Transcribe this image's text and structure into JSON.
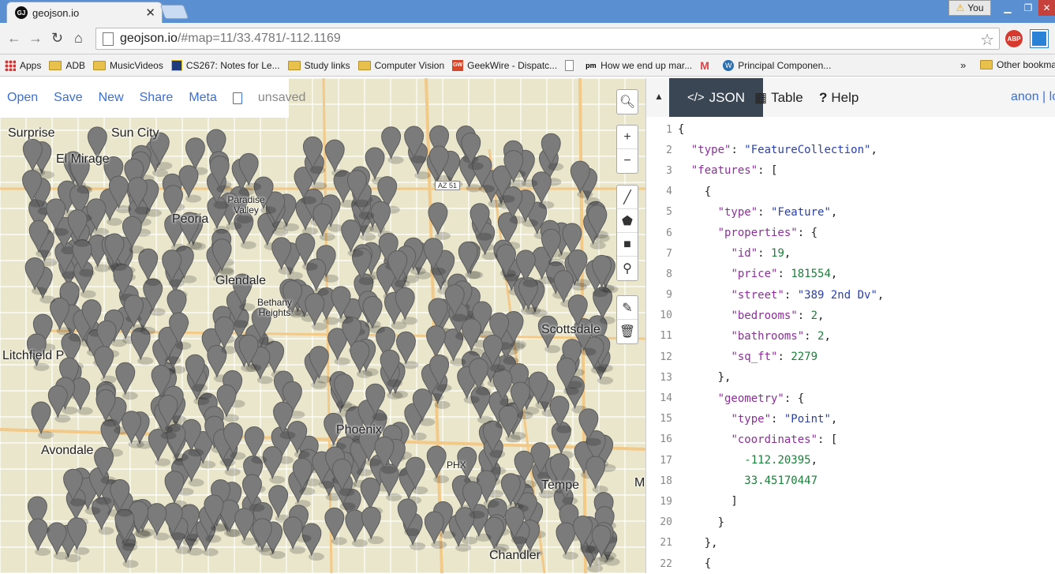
{
  "browser": {
    "tab_title": "geojson.io",
    "tab_favicon": "GJ",
    "profile_label": "You",
    "url_host": "geojson.io",
    "url_path": "/#map=11/33.4781/-112.1169"
  },
  "bookmarks": [
    {
      "label": "Apps",
      "icon": "apps-grid"
    },
    {
      "label": "ADB",
      "icon": "folder"
    },
    {
      "label": "MusicVideos",
      "icon": "folder"
    },
    {
      "label": "CS267: Notes for Le...",
      "icon": "cs-logo"
    },
    {
      "label": "Study links",
      "icon": "folder"
    },
    {
      "label": "Computer Vision",
      "icon": "folder"
    },
    {
      "label": "GeekWire - Dispatc...",
      "icon": "gw-logo"
    },
    {
      "label": "",
      "icon": "page"
    },
    {
      "label": "How we end up mar...",
      "icon": "pm-logo"
    },
    {
      "label": "",
      "icon": "gmail"
    },
    {
      "label": "Principal Componen...",
      "icon": "wordpress"
    }
  ],
  "bookmarks_more": "»",
  "bookmarks_other": "Other bookmarks",
  "map_menu": {
    "open": "Open",
    "save": "Save",
    "new": "New",
    "share": "Share",
    "meta": "Meta",
    "status": "unsaved"
  },
  "map_labels": {
    "surprise": "Surprise",
    "sun_city": "Sun City",
    "el_mirage": "El Mirage",
    "glendale": "Glendale",
    "bethany": "Bethany Heights",
    "litchfield": "Litchfield P",
    "scottsdale": "Scottsdale",
    "phoenix": "Phoenix",
    "avondale": "Avondale",
    "tempe": "Tempe",
    "chandler": "Chandler",
    "mesa": "M",
    "peoria": "Peoria",
    "paradise": "Paradise Valley",
    "phx": "PHX",
    "az51": "AZ 51"
  },
  "map_tools": [
    "search-icon",
    "zoom-in-icon",
    "zoom-out-icon",
    "draw-line-icon",
    "draw-polygon-icon",
    "draw-rectangle-icon",
    "draw-marker-icon",
    "edit-icon",
    "delete-icon"
  ],
  "panel": {
    "tabs": [
      {
        "label": "JSON",
        "icon": "code-icon",
        "active": true
      },
      {
        "label": "Table",
        "icon": "table-icon",
        "active": false
      },
      {
        "label": "Help",
        "icon": "help-icon",
        "active": false
      }
    ],
    "user": "anon | log"
  },
  "code_lines": [
    {
      "n": "1",
      "html": "{"
    },
    {
      "n": "2",
      "html": "  <k>\"type\"</k>: <s>\"FeatureCollection\"</s>,"
    },
    {
      "n": "3",
      "html": "  <k>\"features\"</k>: ["
    },
    {
      "n": "4",
      "html": "    {"
    },
    {
      "n": "5",
      "html": "      <k>\"type\"</k>: <s>\"Feature\"</s>,"
    },
    {
      "n": "6",
      "html": "      <k>\"properties\"</k>: {"
    },
    {
      "n": "7",
      "html": "        <k>\"id\"</k>: <n>19</n>,"
    },
    {
      "n": "8",
      "html": "        <k>\"price\"</k>: <n>181554</n>,"
    },
    {
      "n": "9",
      "html": "        <k>\"street\"</k>: <s>\"389 2nd Dv\"</s>,"
    },
    {
      "n": "10",
      "html": "        <k>\"bedrooms\"</k>: <n>2</n>,"
    },
    {
      "n": "11",
      "html": "        <k>\"bathrooms\"</k>: <n>2</n>,"
    },
    {
      "n": "12",
      "html": "        <k>\"sq_ft\"</k>: <n>2279</n>"
    },
    {
      "n": "13",
      "html": "      },"
    },
    {
      "n": "14",
      "html": "      <k>\"geometry\"</k>: {"
    },
    {
      "n": "15",
      "html": "        <k>\"type\"</k>: <s>\"Point\"</s>,"
    },
    {
      "n": "16",
      "html": "        <k>\"coordinates\"</k>: ["
    },
    {
      "n": "17",
      "html": "          <n>-112.20395</n>,"
    },
    {
      "n": "18",
      "html": "          <n>33.45170447</n>"
    },
    {
      "n": "19",
      "html": "        ]"
    },
    {
      "n": "20",
      "html": "      }"
    },
    {
      "n": "21",
      "html": "    },"
    },
    {
      "n": "22",
      "html": "    {"
    }
  ]
}
